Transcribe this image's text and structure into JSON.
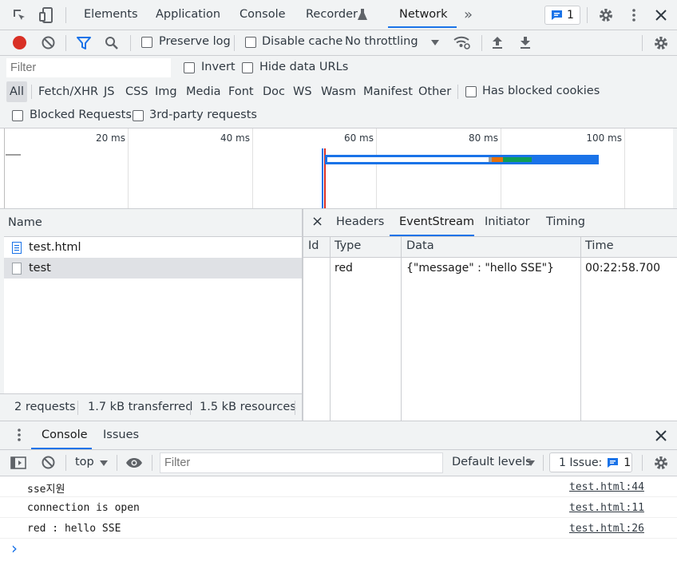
{
  "main_tabs": [
    "Elements",
    "Application",
    "Console",
    "Recorder",
    "Network"
  ],
  "main_tabs_more": "»",
  "issues_badge_count": "1",
  "toolbar": {
    "preserve_log": "Preserve log",
    "disable_cache": "Disable cache",
    "throttling": "No throttling"
  },
  "filter": {
    "placeholder": "Filter",
    "invert": "Invert",
    "hide_data_urls": "Hide data URLs",
    "types": [
      "All",
      "Fetch/XHR",
      "JS",
      "CSS",
      "Img",
      "Media",
      "Font",
      "Doc",
      "WS",
      "Wasm",
      "Manifest",
      "Other"
    ],
    "has_blocked_cookies": "Has blocked cookies",
    "blocked_requests": "Blocked Requests",
    "third_party": "3rd-party requests"
  },
  "timeline": {
    "ticks": [
      "20 ms",
      "40 ms",
      "60 ms",
      "80 ms",
      "100 ms"
    ]
  },
  "request_list": {
    "header": "Name",
    "items": [
      "test.html",
      "test"
    ],
    "status": {
      "requests": "2 requests",
      "transferred": "1.7 kB transferred",
      "resources": "1.5 kB resources"
    }
  },
  "detail": {
    "close": "×",
    "tabs": [
      "Headers",
      "EventStream",
      "Initiator",
      "Timing"
    ],
    "columns": [
      "Id",
      "Type",
      "Data",
      "Time"
    ],
    "rows": [
      {
        "id": "",
        "type": "red",
        "data": "{\"message\" : \"hello SSE\"}",
        "time": "00:22:58.700"
      }
    ]
  },
  "drawer": {
    "tabs": [
      "Console",
      "Issues"
    ],
    "context": "top",
    "filter_placeholder": "Filter",
    "levels": "Default levels",
    "issues_label": "1 Issue:",
    "issues_count": "1",
    "messages": [
      {
        "text": "sse지원",
        "source": "test.html:44"
      },
      {
        "text": "connection is open",
        "source": "test.html:11"
      },
      {
        "text": "red : hello SSE",
        "source": "test.html:26"
      }
    ],
    "prompt": "›"
  },
  "colors": {
    "record": "#d93025",
    "accent": "#1a73e8",
    "bar_blue": "#1a73e8",
    "bar_orange": "#e8710a",
    "bar_green": "#0f9d58"
  }
}
